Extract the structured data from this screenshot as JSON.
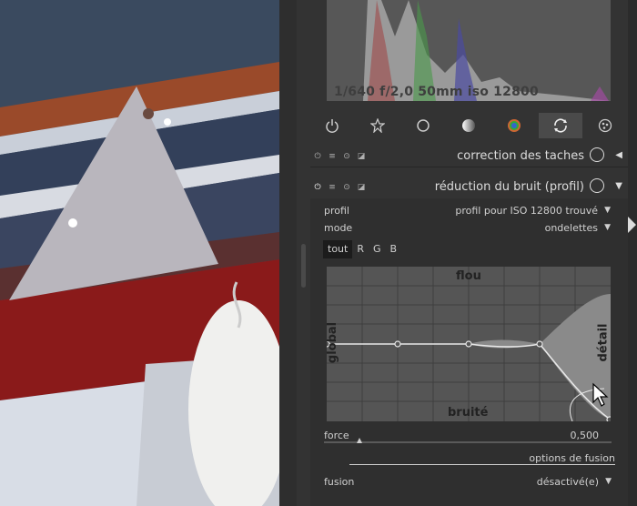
{
  "photo": {
    "description_icon": "photo-canvas"
  },
  "histogram": {
    "exif": "1/640 f/2,0 50mm iso 12800"
  },
  "module_groups": [
    {
      "icon": "power-icon"
    },
    {
      "icon": "star-icon"
    },
    {
      "icon": "circle-icon"
    },
    {
      "icon": "tone-icon"
    },
    {
      "icon": "color-icon"
    },
    {
      "icon": "correct-icon",
      "active": true
    },
    {
      "icon": "effect-icon"
    }
  ],
  "modules": {
    "spot": {
      "title": "correction des taches"
    },
    "denoise": {
      "title": "réduction du bruit (profil)",
      "profil_label": "profil",
      "profil_value": "profil pour ISO 12800 trouvé",
      "mode_label": "mode",
      "mode_value": "ondelettes",
      "channels": [
        "tout",
        "R",
        "G",
        "B"
      ],
      "graph_labels": {
        "top": "flou",
        "bottom": "bruité",
        "left": "global",
        "right": "détail"
      },
      "force_label": "force",
      "force_value": "0,500",
      "force_fraction": 0.12,
      "blend_options": "options de fusion",
      "fusion_label": "fusion",
      "fusion_value": "désactivé(e)"
    }
  },
  "colors": {
    "panel": "#333333",
    "histogram_bg": "#575757",
    "graph_bg": "#555555"
  }
}
